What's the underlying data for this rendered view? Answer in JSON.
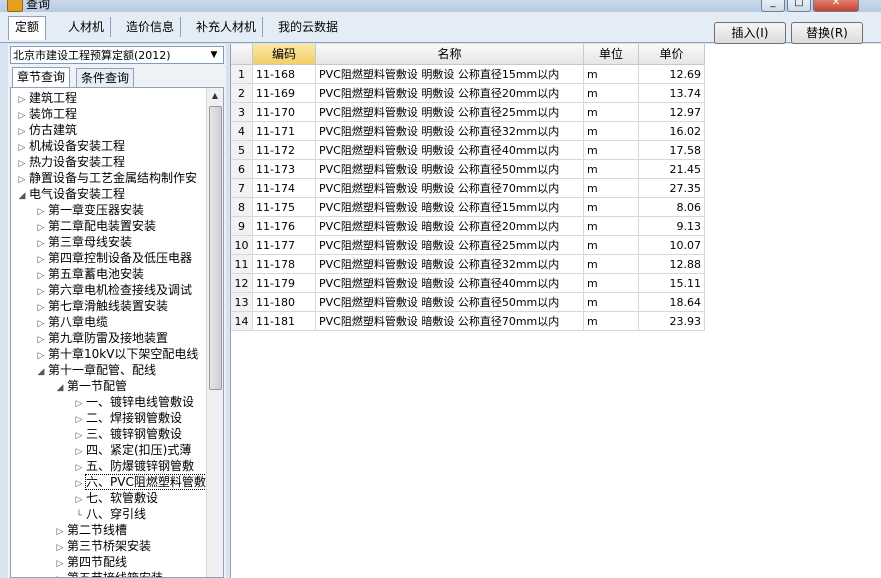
{
  "window": {
    "title": "查询",
    "buttons": [
      "_",
      "□",
      "✕"
    ]
  },
  "tabs": [
    {
      "label": "定额",
      "active": true
    },
    {
      "label": "人材机",
      "active": false
    },
    {
      "label": "造价信息",
      "active": false
    },
    {
      "label": "补充人材机",
      "active": false
    },
    {
      "label": "我的云数据",
      "active": false
    }
  ],
  "actions": {
    "insert": "插入(I)",
    "replace": "替换(R)"
  },
  "left": {
    "dropdown_value": "北京市建设工程预算定额(2012)",
    "subtabs": [
      "章节查询",
      "条件查询"
    ],
    "tree": [
      {
        "label": "建筑工程",
        "level": 0,
        "state": "collapsed"
      },
      {
        "label": "装饰工程",
        "level": 0,
        "state": "collapsed"
      },
      {
        "label": "仿古建筑",
        "level": 0,
        "state": "collapsed"
      },
      {
        "label": "机械设备安装工程",
        "level": 0,
        "state": "collapsed"
      },
      {
        "label": "热力设备安装工程",
        "level": 0,
        "state": "collapsed"
      },
      {
        "label": "静置设备与工艺金属结构制作安",
        "level": 0,
        "state": "collapsed"
      },
      {
        "label": "电气设备安装工程",
        "level": 0,
        "state": "expanded"
      },
      {
        "label": "第一章变压器安装",
        "level": 1,
        "state": "collapsed"
      },
      {
        "label": "第二章配电装置安装",
        "level": 1,
        "state": "collapsed"
      },
      {
        "label": "第三章母线安装",
        "level": 1,
        "state": "collapsed"
      },
      {
        "label": "第四章控制设备及低压电器",
        "level": 1,
        "state": "collapsed"
      },
      {
        "label": "第五章蓄电池安装",
        "level": 1,
        "state": "collapsed"
      },
      {
        "label": "第六章电机检查接线及调试",
        "level": 1,
        "state": "collapsed"
      },
      {
        "label": "第七章滑触线装置安装",
        "level": 1,
        "state": "collapsed"
      },
      {
        "label": "第八章电缆",
        "level": 1,
        "state": "collapsed"
      },
      {
        "label": "第九章防雷及接地装置",
        "level": 1,
        "state": "collapsed"
      },
      {
        "label": "第十章10kV以下架空配电线",
        "level": 1,
        "state": "collapsed"
      },
      {
        "label": "第十一章配管、配线",
        "level": 1,
        "state": "expanded"
      },
      {
        "label": "第一节配管",
        "level": 2,
        "state": "expanded"
      },
      {
        "label": "一、镀锌电线管敷设",
        "level": 3,
        "state": "collapsed"
      },
      {
        "label": "二、焊接钢管敷设",
        "level": 3,
        "state": "collapsed"
      },
      {
        "label": "三、镀锌钢管敷设",
        "level": 3,
        "state": "collapsed"
      },
      {
        "label": "四、紧定(扣压)式薄",
        "level": 3,
        "state": "collapsed"
      },
      {
        "label": "五、防爆镀锌钢管敷",
        "level": 3,
        "state": "collapsed"
      },
      {
        "label": "六、PVC阻燃塑料管敷",
        "level": 3,
        "state": "collapsed",
        "selected": true
      },
      {
        "label": "七、软管敷设",
        "level": 3,
        "state": "collapsed"
      },
      {
        "label": "八、穿引线",
        "level": 3,
        "state": "leaf"
      },
      {
        "label": "第二节线槽",
        "level": 2,
        "state": "collapsed"
      },
      {
        "label": "第三节桥架安装",
        "level": 2,
        "state": "collapsed"
      },
      {
        "label": "第四节配线",
        "level": 2,
        "state": "collapsed"
      },
      {
        "label": "第五节接线箱安装",
        "level": 2,
        "state": "collapsed"
      }
    ]
  },
  "grid": {
    "headers": [
      "",
      "编码",
      "名称",
      "单位",
      "单价"
    ],
    "rows": [
      {
        "n": "1",
        "code": "11-168",
        "name": "PVC阻燃塑料管敷设 明敷设 公称直径15mm以内",
        "unit": "m",
        "price": "12.69"
      },
      {
        "n": "2",
        "code": "11-169",
        "name": "PVC阻燃塑料管敷设 明敷设 公称直径20mm以内",
        "unit": "m",
        "price": "13.74"
      },
      {
        "n": "3",
        "code": "11-170",
        "name": "PVC阻燃塑料管敷设 明敷设 公称直径25mm以内",
        "unit": "m",
        "price": "12.97"
      },
      {
        "n": "4",
        "code": "11-171",
        "name": "PVC阻燃塑料管敷设 明敷设 公称直径32mm以内",
        "unit": "m",
        "price": "16.02"
      },
      {
        "n": "5",
        "code": "11-172",
        "name": "PVC阻燃塑料管敷设 明敷设 公称直径40mm以内",
        "unit": "m",
        "price": "17.58"
      },
      {
        "n": "6",
        "code": "11-173",
        "name": "PVC阻燃塑料管敷设 明敷设 公称直径50mm以内",
        "unit": "m",
        "price": "21.45"
      },
      {
        "n": "7",
        "code": "11-174",
        "name": "PVC阻燃塑料管敷设 明敷设 公称直径70mm以内",
        "unit": "m",
        "price": "27.35"
      },
      {
        "n": "8",
        "code": "11-175",
        "name": "PVC阻燃塑料管敷设 暗敷设 公称直径15mm以内",
        "unit": "m",
        "price": "8.06"
      },
      {
        "n": "9",
        "code": "11-176",
        "name": "PVC阻燃塑料管敷设 暗敷设 公称直径20mm以内",
        "unit": "m",
        "price": "9.13"
      },
      {
        "n": "10",
        "code": "11-177",
        "name": "PVC阻燃塑料管敷设 暗敷设 公称直径25mm以内",
        "unit": "m",
        "price": "10.07"
      },
      {
        "n": "11",
        "code": "11-178",
        "name": "PVC阻燃塑料管敷设 暗敷设 公称直径32mm以内",
        "unit": "m",
        "price": "12.88"
      },
      {
        "n": "12",
        "code": "11-179",
        "name": "PVC阻燃塑料管敷设 暗敷设 公称直径40mm以内",
        "unit": "m",
        "price": "15.11"
      },
      {
        "n": "13",
        "code": "11-180",
        "name": "PVC阻燃塑料管敷设 暗敷设 公称直径50mm以内",
        "unit": "m",
        "price": "18.64"
      },
      {
        "n": "14",
        "code": "11-181",
        "name": "PVC阻燃塑料管敷设 暗敷设 公称直径70mm以内",
        "unit": "m",
        "price": "23.93"
      }
    ]
  }
}
